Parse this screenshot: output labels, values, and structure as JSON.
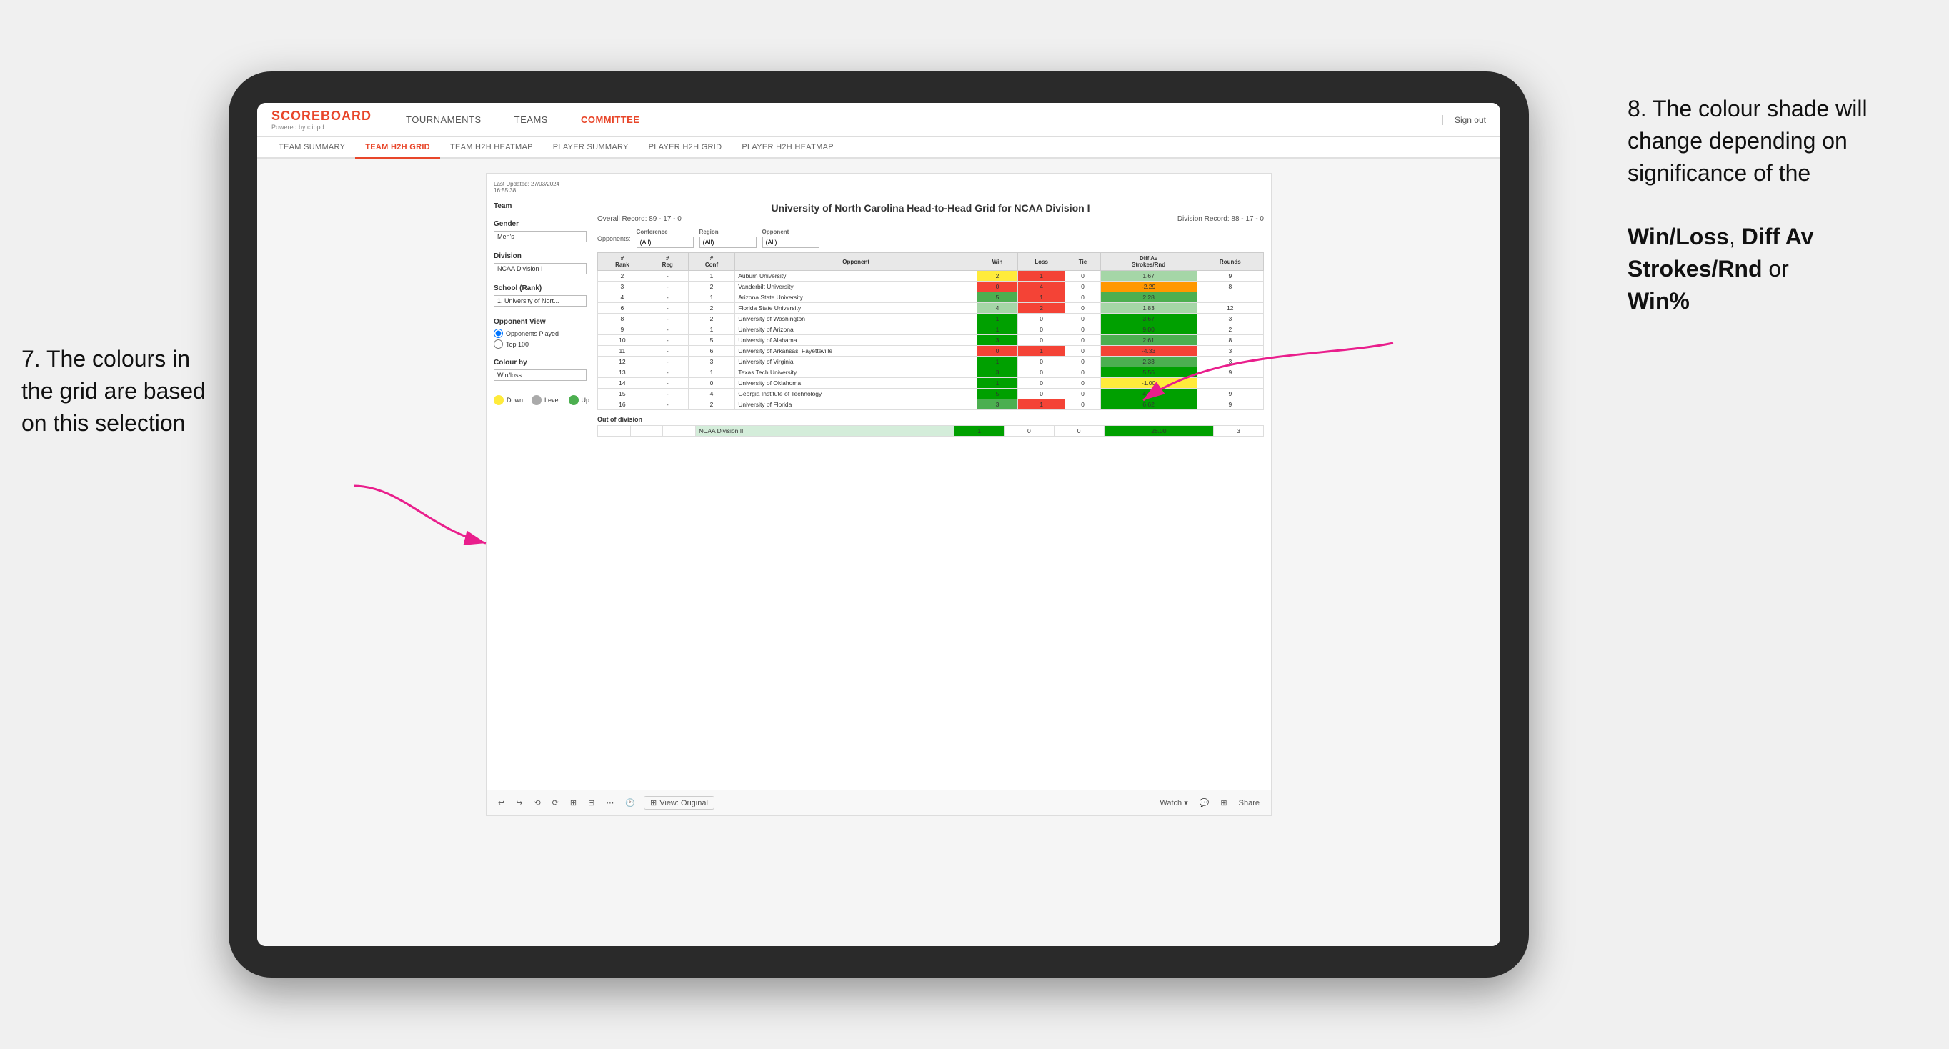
{
  "annotations": {
    "left_title": "7. The colours in the grid are based on this selection",
    "right_title": "8. The colour shade will change depending on significance of the",
    "right_bold1": "Win/Loss",
    "right_sep1": ", ",
    "right_bold2": "Diff Av Strokes/Rnd",
    "right_sep2": " or",
    "right_bold3": "Win%"
  },
  "header": {
    "logo": "SCOREBOARD",
    "logo_sub": "Powered by clippd",
    "nav": [
      "TOURNAMENTS",
      "TEAMS",
      "COMMITTEE"
    ],
    "sign_out": "Sign out"
  },
  "subnav": {
    "items": [
      "TEAM SUMMARY",
      "TEAM H2H GRID",
      "TEAM H2H HEATMAP",
      "PLAYER SUMMARY",
      "PLAYER H2H GRID",
      "PLAYER H2H HEATMAP"
    ],
    "active": "TEAM H2H GRID"
  },
  "panel": {
    "last_updated_label": "Last Updated: 27/03/2024",
    "last_updated_time": "16:55:38",
    "team_label": "Team",
    "gender_label": "Gender",
    "gender_value": "Men's",
    "division_label": "Division",
    "division_value": "NCAA Division I",
    "school_label": "School (Rank)",
    "school_value": "1. University of Nort...",
    "opponent_view_label": "Opponent View",
    "opponents_played": "Opponents Played",
    "top_100": "Top 100",
    "colour_by_label": "Colour by",
    "colour_by_value": "Win/loss"
  },
  "grid": {
    "title": "University of North Carolina Head-to-Head Grid for NCAA Division I",
    "overall_record": "Overall Record: 89 - 17 - 0",
    "division_record": "Division Record: 88 - 17 - 0",
    "filters": {
      "conference_label": "Conference",
      "conference_value": "(All)",
      "region_label": "Region",
      "region_value": "(All)",
      "opponent_label": "Opponent",
      "opponent_value": "(All)",
      "opponents_label": "Opponents:"
    },
    "columns": [
      "#\nRank",
      "#\nReg",
      "#\nConf",
      "Opponent",
      "Win",
      "Loss",
      "Tie",
      "Diff Av\nStrokes/Rnd",
      "Rounds"
    ],
    "rows": [
      {
        "rank": "2",
        "reg": "-",
        "conf": "1",
        "opponent": "Auburn University",
        "win": "2",
        "loss": "1",
        "tie": "0",
        "diff": "1.67",
        "rounds": "9",
        "win_color": "yellow",
        "diff_color": "green_light"
      },
      {
        "rank": "3",
        "reg": "-",
        "conf": "2",
        "opponent": "Vanderbilt University",
        "win": "0",
        "loss": "4",
        "tie": "0",
        "diff": "-2.29",
        "rounds": "8",
        "win_color": "red",
        "diff_color": "orange"
      },
      {
        "rank": "4",
        "reg": "-",
        "conf": "1",
        "opponent": "Arizona State University",
        "win": "5",
        "loss": "1",
        "tie": "0",
        "diff": "2.28",
        "rounds": "",
        "win_color": "green_med",
        "diff_color": "green_med"
      },
      {
        "rank": "6",
        "reg": "-",
        "conf": "2",
        "opponent": "Florida State University",
        "win": "4",
        "loss": "2",
        "tie": "0",
        "diff": "1.83",
        "rounds": "12",
        "win_color": "green_light",
        "diff_color": "green_light"
      },
      {
        "rank": "8",
        "reg": "-",
        "conf": "2",
        "opponent": "University of Washington",
        "win": "1",
        "loss": "0",
        "tie": "0",
        "diff": "3.67",
        "rounds": "3",
        "win_color": "green_dark",
        "diff_color": "green_dark"
      },
      {
        "rank": "9",
        "reg": "-",
        "conf": "1",
        "opponent": "University of Arizona",
        "win": "1",
        "loss": "0",
        "tie": "0",
        "diff": "9.00",
        "rounds": "2",
        "win_color": "green_dark",
        "diff_color": "green_dark"
      },
      {
        "rank": "10",
        "reg": "-",
        "conf": "5",
        "opponent": "University of Alabama",
        "win": "3",
        "loss": "0",
        "tie": "0",
        "diff": "2.61",
        "rounds": "8",
        "win_color": "green_dark",
        "diff_color": "green_med"
      },
      {
        "rank": "11",
        "reg": "-",
        "conf": "6",
        "opponent": "University of Arkansas, Fayetteville",
        "win": "0",
        "loss": "1",
        "tie": "0",
        "diff": "-4.33",
        "rounds": "3",
        "win_color": "red",
        "diff_color": "red"
      },
      {
        "rank": "12",
        "reg": "-",
        "conf": "3",
        "opponent": "University of Virginia",
        "win": "1",
        "loss": "0",
        "tie": "0",
        "diff": "2.33",
        "rounds": "3",
        "win_color": "green_dark",
        "diff_color": "green_med"
      },
      {
        "rank": "13",
        "reg": "-",
        "conf": "1",
        "opponent": "Texas Tech University",
        "win": "3",
        "loss": "0",
        "tie": "0",
        "diff": "5.56",
        "rounds": "9",
        "win_color": "green_dark",
        "diff_color": "green_dark"
      },
      {
        "rank": "14",
        "reg": "-",
        "conf": "0",
        "opponent": "University of Oklahoma",
        "win": "1",
        "loss": "0",
        "tie": "0",
        "diff": "-1.00",
        "rounds": "",
        "win_color": "green_dark",
        "diff_color": "yellow"
      },
      {
        "rank": "15",
        "reg": "-",
        "conf": "4",
        "opponent": "Georgia Institute of Technology",
        "win": "5",
        "loss": "0",
        "tie": "0",
        "diff": "4.50",
        "rounds": "9",
        "win_color": "green_dark",
        "diff_color": "green_dark"
      },
      {
        "rank": "16",
        "reg": "-",
        "conf": "2",
        "opponent": "University of Florida",
        "win": "3",
        "loss": "1",
        "tie": "0",
        "diff": "6.62",
        "rounds": "9",
        "win_color": "green_med",
        "diff_color": "green_dark"
      }
    ],
    "out_of_division_label": "Out of division",
    "out_of_division_row": {
      "name": "NCAA Division II",
      "win": "1",
      "loss": "0",
      "tie": "0",
      "diff": "26.00",
      "rounds": "3",
      "win_color": "green_dark",
      "diff_color": "green_dark"
    }
  },
  "legend": {
    "down_label": "Down",
    "level_label": "Level",
    "up_label": "Up"
  },
  "toolbar": {
    "view_original": "View: Original",
    "watch": "Watch ▾",
    "share": "Share"
  }
}
